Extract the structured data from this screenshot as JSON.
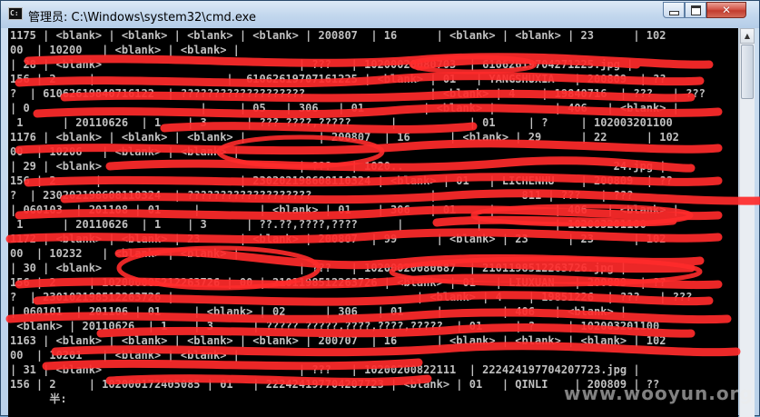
{
  "window": {
    "title": "管理员: C:\\Windows\\system32\\cmd.exe",
    "icon": "cmd-icon"
  },
  "console": {
    "lines": [
      "1175 | <blank> | <blank> | <blank> | <blank> | 200807  | 16      | <blank> | <blank> | 23      | 102",
      "00  | 10200   | <blank> | <blank> |",
      "| 28 | <blank>                              | ???   | 10200020080703  | 61062619704271225.jpg |",
      "156 | 2     |                    |  61062619707161225 | <blank> | 01   | YANGSHUXIA   | 200809  | ??",
      "?  | 61062619840716122  | ???????????????????                   | <blank> | 4    | 19840716  | ???   | ???",
      "| 0                          |     | 05   | 306   | 01         | <blank> |         | 406   | <blank> |",
      " 1      | 20110626  | 1    | 3      | ??? ????,?????      |           | 01     | ?     | 102003201100",
      "1176 | <blank> | <blank> | <blank> |           | 200807  | 16      | <blank> | 29      | 22      | 102",
      "00  | 10206   | <blank> | <blank> |",
      "| 29 | <blank>                              | ???   | 1020..                                24.jpg |",
      "156 | 2      |                     | 230202198608110324 | <blank> | 01   | LICHENHU    | 200809  | ??",
      "?  | 230202198608110324  | ???????????????????                  |             811 | ???   | ???",
      "| 060103  | 201108 | 01     |         | <blank> | 01    | 306   | 01     |         | 406   | <blank> |",
      " 1      | 20110626  | 1    | 3      | ??.??,????,????      |           |           | 102003201100",
      "1172 | <blank> | <blank> | 23      | <blank> | 200807  | 99      | <blank> | 23      | 23      | 102",
      "00  | 10232   | <blank> | <blank> |",
      "| 30 | <blank>                              | ???   | 10200020080687  | 2101198512263726.jpg |",
      "156 | 2     | 102000005212263726 | 00 | 2101198512263726 | <blank> | 01   | LIUXUAN   | 200809  | ??",
      "?  | 230102198512263726 |                                     | <blank> | 4    | 19851226  | ???   | ???",
      "| 060101  | 201106 | 01     | <blank> | 02      | 306   | 01     |         | 406   | <blank> |",
      " <blank> | 20110626  | 1    | 3      | ????? ?????,????,????,?????  | 01     | ?     | 102003201100",
      "1163 | <blank> | <blank> | <blank> | <blank> | 200707  | 16      | <blank> | <blank> | <blank> | 102",
      "00  | 10201   | <blank> | <blank> |",
      "| 31 | <blank>                              | ???   | 10200200822111  | 222424197704207723.jpg |",
      "156 | 2     | 102000172405085 | 01   | 222424197704207723 | <blank> | 01   | QINLI    | 200809 | ??",
      "      半:"
    ]
  },
  "watermark": "www.wooyun.org",
  "colors": {
    "console_bg": "#000000",
    "console_text": "#c0c0c0",
    "redaction": "#ff2b2b"
  }
}
